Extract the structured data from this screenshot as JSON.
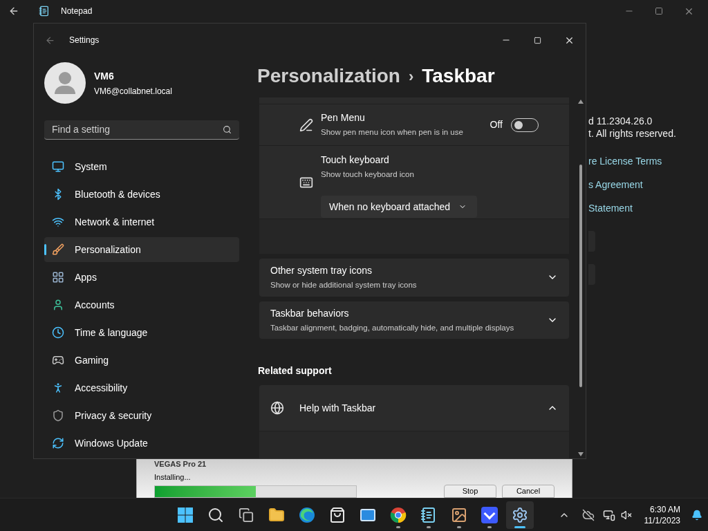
{
  "notepad": {
    "title": "Notepad",
    "about_lines": [
      {
        "text": "d 11.2304.26.0",
        "kind": "text"
      },
      {
        "text": "t. All rights reserved.",
        "kind": "text"
      },
      {
        "text": "re License Terms",
        "kind": "link"
      },
      {
        "text": "s Agreement",
        "kind": "link"
      },
      {
        "text": "Statement",
        "kind": "link"
      }
    ]
  },
  "installer": {
    "title": "VEGAS Pro 21",
    "status": "Installing...",
    "progress": {
      "level": 0.5
    },
    "buttons": [
      "Stop",
      "Cancel"
    ]
  },
  "settings": {
    "title": "Settings",
    "user": {
      "name": "VM6",
      "email": "VM6@collabnet.local"
    },
    "search": {
      "placeholder": "Find a setting"
    },
    "nav": [
      {
        "label": "System",
        "selected": false
      },
      {
        "label": "Bluetooth & devices",
        "selected": false
      },
      {
        "label": "Network & internet",
        "selected": false
      },
      {
        "label": "Personalization",
        "selected": true
      },
      {
        "label": "Apps",
        "selected": false
      },
      {
        "label": "Accounts",
        "selected": false
      },
      {
        "label": "Time & language",
        "selected": false
      },
      {
        "label": "Gaming",
        "selected": false
      },
      {
        "label": "Accessibility",
        "selected": false
      },
      {
        "label": "Privacy & security",
        "selected": false
      },
      {
        "label": "Windows Update",
        "selected": false
      }
    ],
    "breadcrumb": {
      "parent": "Personalization",
      "separator": "›",
      "current": "Taskbar"
    },
    "rows": [
      {
        "kind": "toggle",
        "title": "Pen Menu",
        "description": "Show pen menu icon when pen is in use",
        "state_label": "Off",
        "on": false
      },
      {
        "kind": "dropdown",
        "title": "Touch keyboard",
        "description": "Show touch keyboard icon",
        "value": "When no keyboard attached"
      }
    ],
    "sections": [
      {
        "title": "Other system tray icons",
        "description": "Show or hide additional system tray icons",
        "expanded": false
      },
      {
        "title": "Taskbar behaviors",
        "description": "Taskbar alignment, badging, automatically hide, and multiple displays",
        "expanded": false
      }
    ],
    "related": {
      "heading": "Related support",
      "items": [
        {
          "title": "Help with Taskbar",
          "expanded": true
        }
      ]
    }
  },
  "taskbar": {
    "apps": [
      {
        "running": false,
        "selected": false
      },
      {
        "running": false,
        "selected": false
      },
      {
        "running": false,
        "selected": false
      },
      {
        "running": false,
        "selected": false
      },
      {
        "running": false,
        "selected": false
      },
      {
        "running": false,
        "selected": false
      },
      {
        "running": false,
        "selected": false
      },
      {
        "running": true,
        "selected": false
      },
      {
        "running": true,
        "selected": false
      },
      {
        "running": true,
        "selected": false
      },
      {
        "running": true,
        "selected": false
      },
      {
        "running": true,
        "selected": true
      }
    ],
    "clock": {
      "time": "6:30 AM",
      "date": "11/1/2023"
    }
  }
}
